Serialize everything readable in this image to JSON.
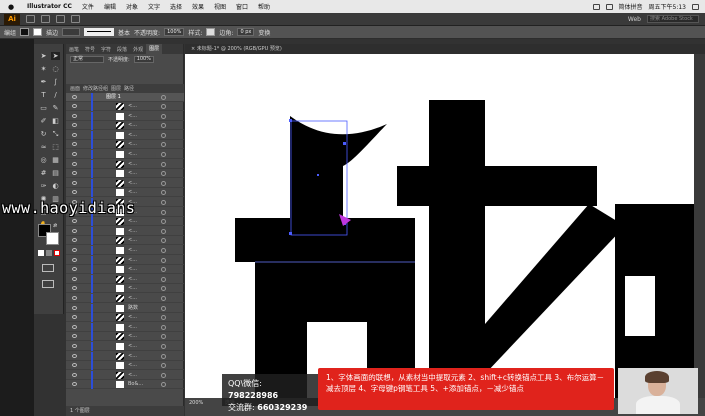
{
  "menubar": {
    "app": "Illustrator CC",
    "items": [
      "文件",
      "编辑",
      "对象",
      "文字",
      "选择",
      "效果",
      "视图",
      "窗口",
      "帮助"
    ],
    "input_method": "简体拼音",
    "clock": "周五下午5:13"
  },
  "appbar": {
    "logo": "Ai",
    "workspace": "Web",
    "search_placeholder": "搜索 Adobe Stock"
  },
  "control_bar": {
    "selection_label": "编组",
    "stroke_label": "描边",
    "stroke_style": "基本",
    "opacity_label": "不透明度:",
    "opacity_value": "100%",
    "style_label": "样式:",
    "offset_label": "边角:",
    "offset_value": "0 px",
    "transform_label": "变换"
  },
  "layers_panel": {
    "tabs": [
      "画笔",
      "符号",
      "字符",
      "段落",
      "外观",
      "图层"
    ],
    "active_tab": "图层",
    "blend_mode": "正常",
    "opacity_label": "不透明度:",
    "opacity_value": "100%",
    "subheader": [
      "画面",
      "修改路径组",
      "图层",
      "路径"
    ],
    "top_layer": "图层 1",
    "row_label": "<...",
    "group_label": "路数",
    "bottom_label": "Bo&...",
    "footer": "1 个图层"
  },
  "canvas": {
    "doc_tab": "× 未标题-1* @ 200% (RGB/GPU 预览)",
    "zoom": "200%",
    "status": "选择"
  },
  "watermark": "www.haoyidians",
  "qq": {
    "line1_label": "QQ\\微信:",
    "line1_value": "798228986",
    "line2_label": "交流群:",
    "line2_value": "660329239"
  },
  "subtitle": "1、字体画面的联想，从素材当中提取元素  2、shift+c转换锚点工具  3、布尔运算－减去顶层  4、字母键p钢笔工具  5、+添加锚点，－减少锚点",
  "colors": {
    "accent_orange": "#ff9a00",
    "layer_blue": "#2c4ed8",
    "subtitle_red": "#e0231c"
  }
}
